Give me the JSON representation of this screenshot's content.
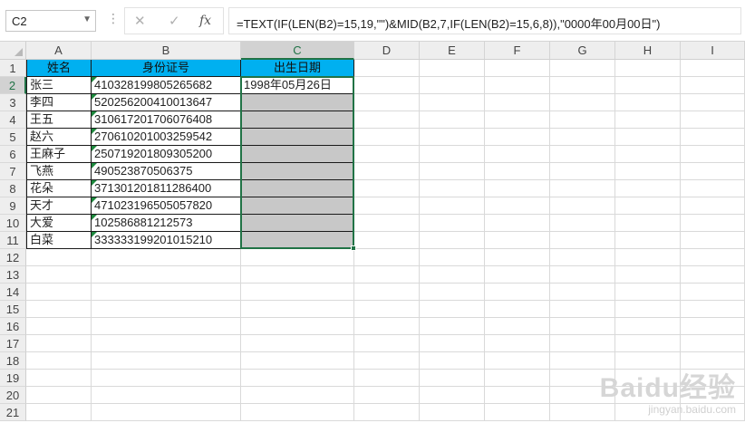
{
  "name_box": {
    "value": "C2"
  },
  "formula_bar": {
    "cancel_glyph": "✕",
    "enter_glyph": "✓",
    "fx_label": "fx",
    "formula": "=TEXT(IF(LEN(B2)=15,19,\"\")&MID(B2,7,IF(LEN(B2)=15,6,8)),\"0000年00月00日\")"
  },
  "columns": [
    "A",
    "B",
    "C",
    "D",
    "E",
    "F",
    "G",
    "H",
    "I"
  ],
  "selected_column": "C",
  "selected_row": 2,
  "rows": [
    "1",
    "2",
    "3",
    "4",
    "5",
    "6",
    "7",
    "8",
    "9",
    "10",
    "11",
    "12",
    "13",
    "14",
    "15",
    "16",
    "17",
    "18",
    "19",
    "20",
    "21"
  ],
  "table": {
    "headers": [
      "姓名",
      "身份证号",
      "出生日期"
    ],
    "records": [
      {
        "name": "张三",
        "id": "410328199805265682",
        "birth": "1998年05月26日"
      },
      {
        "name": "李四",
        "id": "520256200410013647",
        "birth": ""
      },
      {
        "name": "王五",
        "id": "310617201706076408",
        "birth": ""
      },
      {
        "name": "赵六",
        "id": "270610201003259542",
        "birth": ""
      },
      {
        "name": "王麻子",
        "id": "250719201809305200",
        "birth": ""
      },
      {
        "name": "飞燕",
        "id": "490523870506375",
        "birth": ""
      },
      {
        "name": "花朵",
        "id": "371301201811286400",
        "birth": ""
      },
      {
        "name": "天才",
        "id": "471023196505057820",
        "birth": ""
      },
      {
        "name": "大爱",
        "id": "102586881212573",
        "birth": ""
      },
      {
        "name": "白菜",
        "id": "333333199201015210",
        "birth": ""
      }
    ]
  },
  "colors": {
    "header_fill": "#00b0f0",
    "selection": "#217346",
    "grey_fill": "#c8c8c8"
  },
  "watermark": {
    "main": "Baidu经验",
    "sub": "jingyan.baidu.com"
  }
}
